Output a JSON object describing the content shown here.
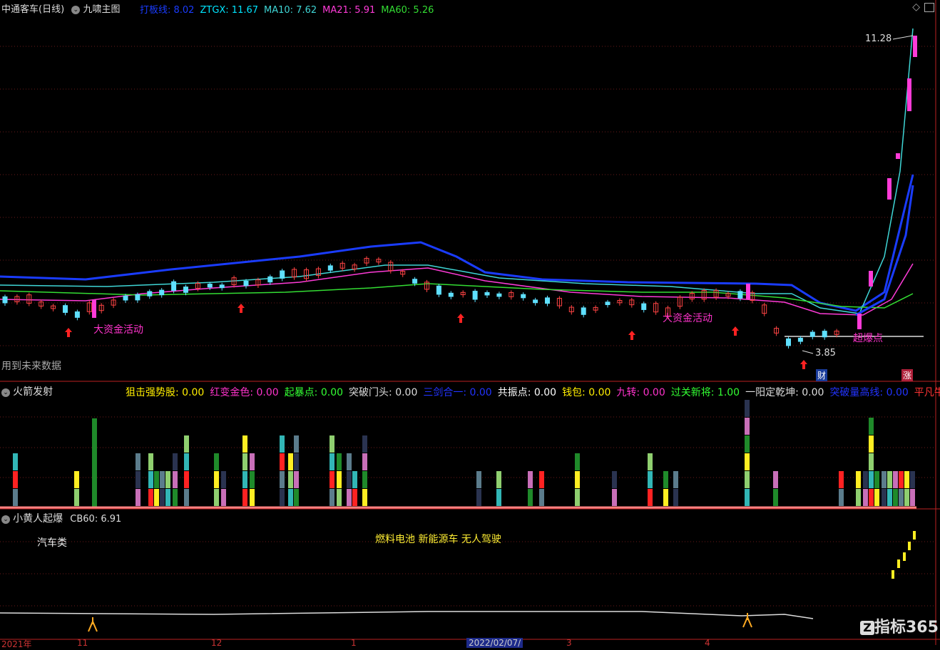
{
  "main_panel": {
    "stock_title": "中通客车(日线)",
    "indicator_name": "九啸主图",
    "readouts": [
      {
        "label": "打板线:",
        "value": "8.02",
        "color": "#1a3cff"
      },
      {
        "label": "ZTGX:",
        "value": "11.67",
        "color": "#00e5ff"
      },
      {
        "label": "MA10:",
        "value": "7.62",
        "color": "#3fd6d6"
      },
      {
        "label": "MA21:",
        "value": "5.91",
        "color": "#ff3bd8"
      },
      {
        "label": "MA60:",
        "value": "5.26",
        "color": "#33dd33"
      }
    ],
    "high_label": "11.28",
    "low_label": "3.85",
    "annotations": [
      "大资金活动",
      "大资金活动",
      "超爆点"
    ],
    "footer_note": "用到未来数据",
    "badges": {
      "cai": "财",
      "zhang": "涨"
    }
  },
  "middle_panel": {
    "indicator_name": "火箭发射",
    "readouts": [
      {
        "label": "狙击强势股:",
        "value": "0.00",
        "color": "#ffee00"
      },
      {
        "label": "红变金色:",
        "value": "0.00",
        "color": "#ff33cc"
      },
      {
        "label": "起暴点:",
        "value": "0.00",
        "color": "#33ff33"
      },
      {
        "label": "突破门头:",
        "value": "0.00",
        "color": "#dddddd"
      },
      {
        "label": "三剑合一:",
        "value": "0.00",
        "color": "#2233ff"
      },
      {
        "label": "共振点:",
        "value": "0.00",
        "color": "#ffffff"
      },
      {
        "label": "钱包:",
        "value": "0.00",
        "color": "#ffee00"
      },
      {
        "label": "九转:",
        "value": "0.00",
        "color": "#ff33cc"
      },
      {
        "label": "过关新将:",
        "value": "1.00",
        "color": "#33ff33"
      },
      {
        "label": "一阳定乾坤:",
        "value": "0.00",
        "color": "#dddddd"
      },
      {
        "label": "突破量高线:",
        "value": "0.00",
        "color": "#2233ff"
      },
      {
        "label": "平凡牛",
        "value": "",
        "color": "#ff3333"
      }
    ]
  },
  "bottom_panel": {
    "indicator_name": "小黄人起爆",
    "readout_label": "CB60:",
    "readout_value": "6.91",
    "sector_label": "汽车类",
    "concept_label": "燃料电池 新能源车 无人驾驶"
  },
  "x_axis": {
    "labels": [
      "2021年",
      "11",
      "12",
      "1",
      "2022/02/07/",
      "3",
      "4"
    ]
  },
  "watermark": "指标365",
  "icons": {
    "collapse": "chevron-down-icon",
    "diamond": "diamond-icon",
    "window": "window-icon"
  }
}
